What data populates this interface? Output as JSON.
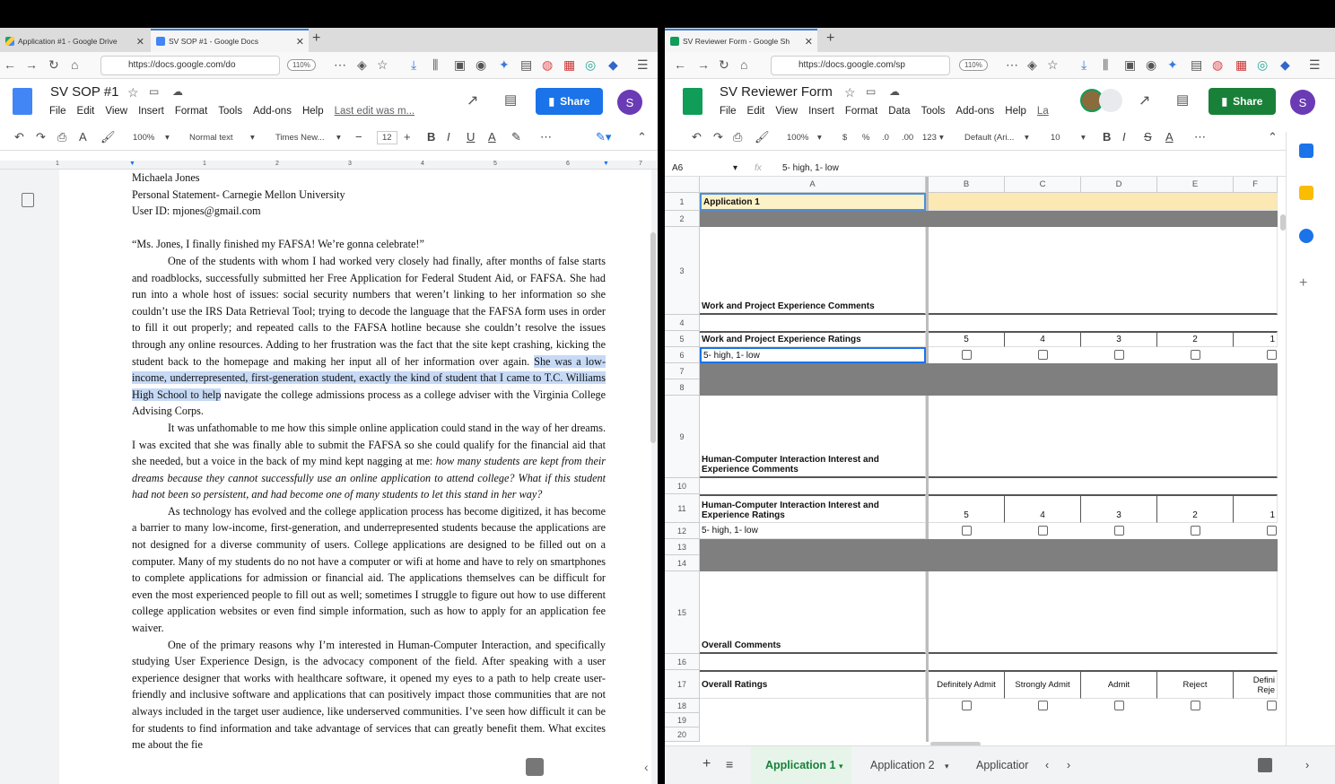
{
  "left_window": {
    "tabs": [
      {
        "label": "Application #1 - Google Drive"
      },
      {
        "label": "SV SOP #1 - Google Docs"
      }
    ],
    "url": "https://docs.google.com/do",
    "zoom": "110%",
    "doc": {
      "title": "SV SOP #1",
      "menus": [
        "File",
        "Edit",
        "View",
        "Insert",
        "Format",
        "Tools",
        "Add-ons",
        "Help"
      ],
      "last_edit": "Last edit was m...",
      "share_label": "Share",
      "avatar_letter": "S",
      "toolbar": {
        "zoom": "100%",
        "style": "Normal text",
        "font": "Times New...",
        "size": "12",
        "ruler_marks": [
          "1",
          "1",
          "2",
          "3",
          "4",
          "5",
          "6",
          "7"
        ]
      },
      "header_lines": [
        "Michaela Jones",
        "Personal Statement- Carnegie Mellon University",
        "User ID: mjones@gmail.com"
      ],
      "quote": "“Ms. Jones, I finally finished my FAFSA! We’re gonna celebrate!”",
      "p1_a": "One of the students with whom I had worked very closely had finally, after months of false starts and roadblocks, successfully submitted her Free Application for Federal Student Aid, or FAFSA. She had run into a whole host of issues: social security numbers that weren’t linking to her information so she couldn’t use the IRS Data Retrieval Tool; trying to decode the language that the FAFSA form uses in order to fill it out properly; and repeated calls to the FAFSA hotline because she couldn’t resolve the issues through any online resources. Adding to her frustration was the fact that the site kept crashing, kicking the student back to the homepage and making her input all of her information over again. ",
      "p1_highlight": "She was a low-income, underrepresented, first-generation student, exactly the kind of student that I came to T.C. Williams High School to help",
      "p1_b": " navigate the college admissions process as a college adviser with the Virginia College Advising Corps.",
      "p2_a": "It was unfathomable to me how this simple online application could stand in the way of her dreams. I was excited that she was finally able to submit the FAFSA so she could qualify for the financial aid that she needed, but a voice in the back of my mind kept nagging at me: ",
      "p2_italic": "how many students are kept from their dreams because they cannot successfully use an online application to attend college? What if this student had not been so persistent, and had become one of many students to let this stand in her way?",
      "p3": "As technology has evolved and the college application process has become digitized, it has become a barrier to many low-income, first-generation, and underrepresented students because the applications are not designed for a diverse community of users. College applications are designed to be filled out on a computer. Many of my students do no not have a computer or wifi at home and have to rely on smartphones to complete applications for admission or financial aid. The applications themselves can be difficult for even the most experienced people to fill out as well; sometimes I struggle to figure out how to use different college application websites or even find simple information, such as how to apply for an application fee waiver.",
      "p4": "One of the primary reasons why I’m interested in Human-Computer Interaction, and specifically studying User Experience Design, is the advocacy component of the field. After speaking with a user experience designer that works with healthcare software, it opened my eyes to a path to help create user-friendly and inclusive software and applications that can positively impact those communities that are not always included in the target user audience, like underserved communities. I’ve seen how difficult it can be for students to find information and take advantage of services that can greatly benefit them. What excites me about the fie"
    }
  },
  "right_window": {
    "tab_label": "SV Reviewer Form - Google Sh",
    "url": "https://docs.google.com/sp",
    "zoom": "110%",
    "sheet": {
      "title": "SV Reviewer Form",
      "menus": [
        "File",
        "Edit",
        "View",
        "Insert",
        "Format",
        "Data",
        "Tools",
        "Add-ons",
        "Help",
        "La"
      ],
      "share_label": "Share",
      "avatar_letter": "S",
      "toolbar": {
        "zoom": "100%",
        "currency": "$",
        "percent": "%",
        "dec1": ".0",
        "dec2": ".00",
        "format": "123",
        "font": "Default (Ari...",
        "size": "10"
      },
      "name_box": "A6",
      "formula": "5- high, 1- low",
      "columns": [
        "A",
        "B",
        "C",
        "D",
        "E",
        "F"
      ],
      "rows": [
        "1",
        "2",
        "3",
        "4",
        "5",
        "6",
        "7",
        "8",
        "9",
        "10",
        "11",
        "12",
        "13",
        "14",
        "15",
        "16",
        "17",
        "18",
        "19",
        "20"
      ],
      "a1": "Application 1",
      "a3": "Work and Project Experience Comments",
      "a5": "Work and Project Experience Ratings",
      "a6": "5- high, 1- low",
      "a9": "Human-Computer Interaction Interest and Experience Comments",
      "a11": "Human-Computer Interaction Interest and Experience Ratings",
      "a12": "5- high, 1- low",
      "a15": "Overall Comments",
      "a17": "Overall Ratings",
      "ratings": [
        "5",
        "4",
        "3",
        "2",
        "1"
      ],
      "overall": [
        "Definitely Admit",
        "Strongly Admit",
        "Admit",
        "Reject",
        "Defini Reje"
      ],
      "sheet_tabs": [
        "Application 1",
        "Application 2",
        "Applicatior"
      ]
    }
  }
}
